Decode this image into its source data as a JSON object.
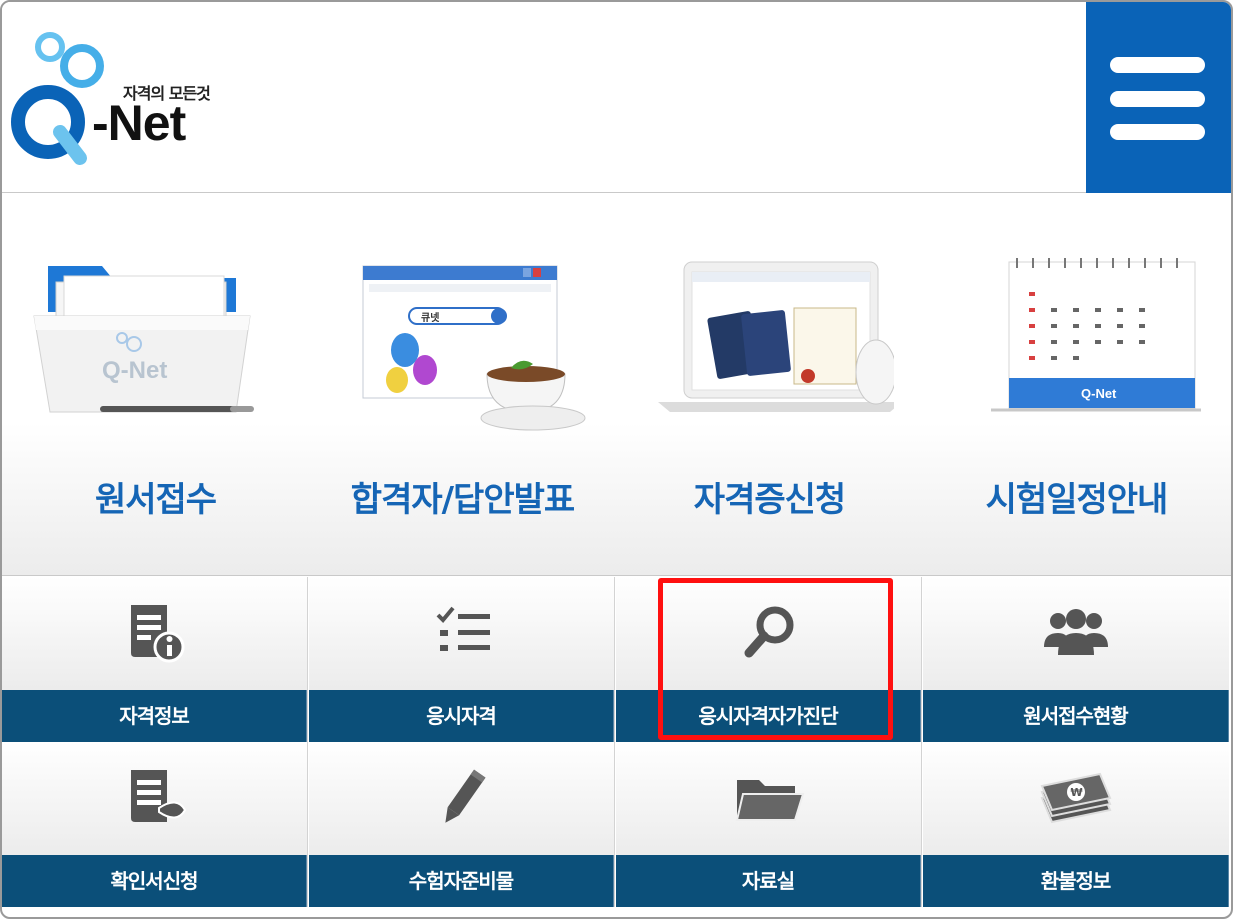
{
  "header": {
    "logo_tagline": "자격의 모든것",
    "logo_name": "-Net",
    "logo_letter": "Q",
    "menu_icon": "hamburger-menu-icon"
  },
  "main_menu": [
    {
      "label": "원서접수",
      "icon": "folder-illustration"
    },
    {
      "label": "합격자/답안발표",
      "icon": "browser-teacup-illustration"
    },
    {
      "label": "자격증신청",
      "icon": "laptop-certificate-illustration"
    },
    {
      "label": "시험일정안내",
      "icon": "calendar-illustration"
    }
  ],
  "tiles": [
    {
      "label": "자격정보",
      "icon": "document-info-icon"
    },
    {
      "label": "응시자격",
      "icon": "checklist-icon"
    },
    {
      "label": "응시자격자가진단",
      "icon": "search-icon"
    },
    {
      "label": "원서접수현황",
      "icon": "users-group-icon"
    },
    {
      "label": "확인서신청",
      "icon": "document-edit-icon"
    },
    {
      "label": "수험자준비물",
      "icon": "pencil-icon"
    },
    {
      "label": "자료실",
      "icon": "folder-icon"
    },
    {
      "label": "환불정보",
      "icon": "money-icon"
    }
  ],
  "illustration_text": {
    "browser_search": "큐넷",
    "folder_brand": "Q-Net",
    "calendar_brand": "Q-Net"
  },
  "colors": {
    "brand_blue": "#0a63b7",
    "label_blue": "#1565b5",
    "tile_bar": "#0b4f79",
    "highlight": "#ff1010",
    "icon_gray": "#555555"
  }
}
